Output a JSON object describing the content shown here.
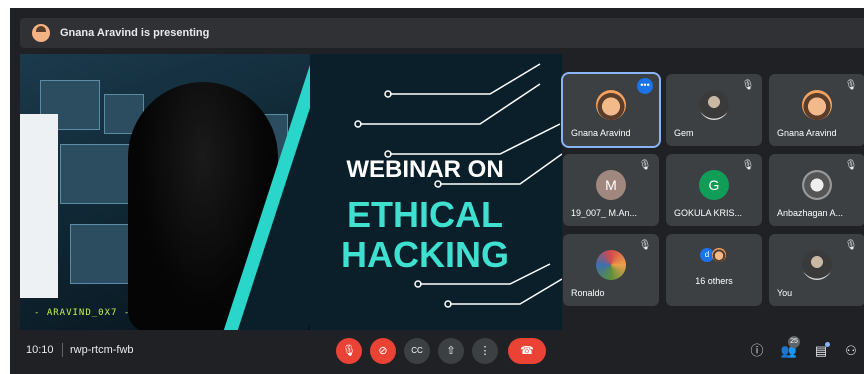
{
  "presenting_banner": {
    "text": "Gnana Aravind is presenting"
  },
  "slide": {
    "line1": "WEBINAR ON",
    "line2": "ETHICAL",
    "line3": "HACKING",
    "watermark": "- ARAVIND_0X7 -"
  },
  "participants": [
    {
      "name": "Gnana Aravind",
      "avatar": "photo-face",
      "indicator": "more-options",
      "active": true
    },
    {
      "name": "Gem",
      "avatar": "photo-dark",
      "indicator": "muted"
    },
    {
      "name": "Gnana Aravind",
      "avatar": "photo-face",
      "indicator": "muted"
    },
    {
      "name": "19_007_ M.An...",
      "avatar_letter": "M",
      "avatar_color": "#a1887f",
      "indicator": "muted"
    },
    {
      "name": "GOKULA KRIS...",
      "avatar_letter": "G",
      "avatar_color": "#0f9d58",
      "indicator": "muted"
    },
    {
      "name": "Anbazhagan A...",
      "avatar": "photo-bw",
      "indicator": "muted"
    },
    {
      "name": "Ronaldo",
      "avatar": "photo-color",
      "indicator": "muted"
    },
    {
      "name": "16 others",
      "group_letter": "d",
      "group_letter_color": "#1a73e8"
    },
    {
      "name": "You",
      "avatar": "photo-dark",
      "indicator": "muted"
    }
  ],
  "footer": {
    "time": "10:10",
    "meeting_code": "rwp-rtcm-fwb",
    "controls": [
      {
        "name": "mic-off-icon",
        "glyph": "🎙",
        "color": "#ea4335"
      },
      {
        "name": "camera-off-icon",
        "glyph": "⊘",
        "color": "#ea4335"
      },
      {
        "name": "captions-icon",
        "glyph": "CC",
        "color": "#3c4043"
      },
      {
        "name": "present-icon",
        "glyph": "⇧",
        "color": "#3c4043"
      },
      {
        "name": "more-options-icon",
        "glyph": "⋮",
        "color": "#3c4043"
      }
    ],
    "end_call_glyph": "☎",
    "participant_count": "25",
    "right_icons": [
      {
        "name": "info-icon",
        "glyph": "ⓘ"
      },
      {
        "name": "people-icon",
        "glyph": "👥"
      },
      {
        "name": "chat-icon",
        "glyph": "▤"
      },
      {
        "name": "activities-icon",
        "glyph": "⚇"
      }
    ]
  },
  "colors": {
    "background": "#202124",
    "tile": "#3c4043",
    "accent_red": "#ea4335",
    "slide_teal": "#3fe0d0",
    "active_outline": "#8ab4f8"
  }
}
